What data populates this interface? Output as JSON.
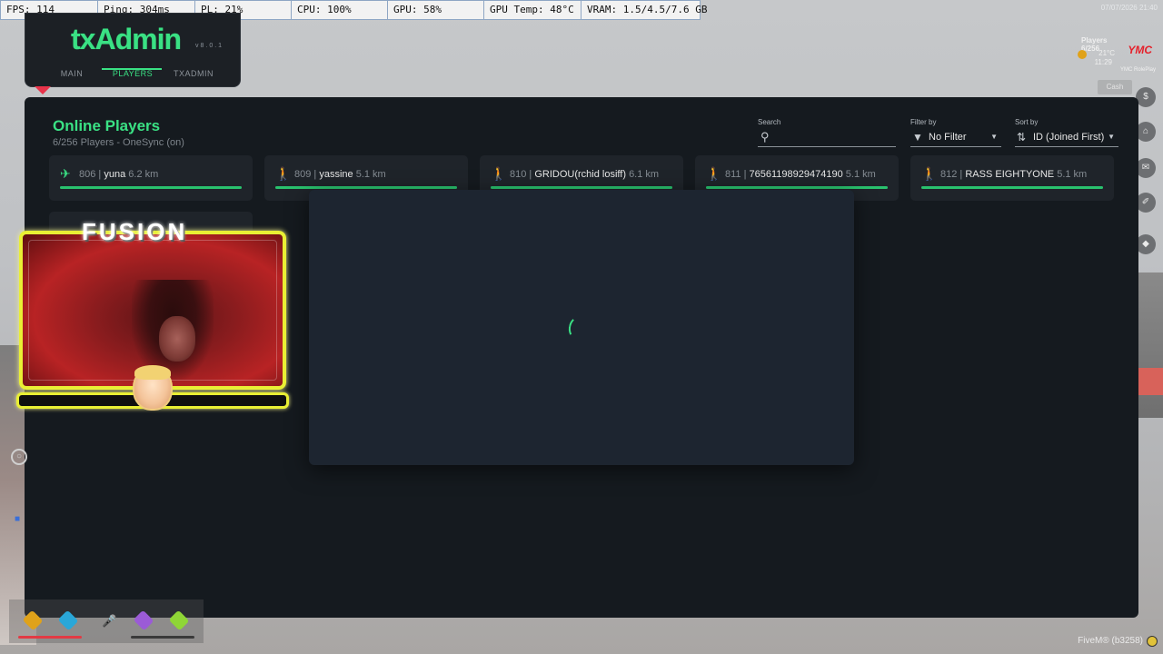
{
  "perf_bar": {
    "fps": "FPS: 114",
    "ping": "Ping: 304ms",
    "pl": "PL: 21%",
    "cpu": "CPU: 100%",
    "gpu": "GPU: 58%",
    "gpu_temp": "GPU Temp: 48°C",
    "vram": "VRAM: 1.5/4.5/7.6 GB"
  },
  "game_hud": {
    "date": "07/07/2026 21:40",
    "players": "Players 6/256",
    "logo": "YMC",
    "weather": "21°C",
    "clock": "11:29",
    "server": "YMC RolePlay",
    "cash": "Cash",
    "side_icons": [
      "$",
      "⌂",
      "✉",
      "✐",
      "◆"
    ],
    "fivem_label": "FiveM® (b3258)"
  },
  "txadmin": {
    "logo": "txAdmin",
    "version": "v8.0.1",
    "tabs": [
      {
        "label": "MAIN",
        "active": false
      },
      {
        "label": "PLAYERS",
        "active": true
      },
      {
        "label": "TXADMIN",
        "active": false
      }
    ]
  },
  "players_panel": {
    "title": "Online Players",
    "subtitle": "6/256 Players - OneSync (on)",
    "search": {
      "label": "Search",
      "value": ""
    },
    "filter": {
      "label": "Filter by",
      "value": "No Filter"
    },
    "sort": {
      "label": "Sort by",
      "value": "ID (Joined First)"
    },
    "players": [
      {
        "id": "806",
        "name": "yuna",
        "distance": "6.2 km",
        "icon": "plane-icon",
        "health": 1.0
      },
      {
        "id": "809",
        "name": "yassine",
        "distance": "5.1 km",
        "icon": "walking-icon",
        "health": 1.0
      },
      {
        "id": "810",
        "name": "GRIDOU(rchid losiff)",
        "distance": "6.1 km",
        "icon": "walking-icon",
        "health": 1.0
      },
      {
        "id": "811",
        "name": "76561198929474190",
        "distance": "5.1 km",
        "icon": "walking-icon",
        "health": 1.0
      },
      {
        "id": "812",
        "name": "RASS EIGHTYONE",
        "distance": "5.1 km",
        "icon": "walking-icon",
        "health": 1.0
      }
    ]
  },
  "modal": {
    "state": "loading"
  },
  "webcam": {
    "title": "FUSION"
  },
  "colors": {
    "accent": "#3ae184",
    "panel_bg": "#151a1f",
    "card_bg": "#1f242a",
    "modal_bg": "#1d2530",
    "webcam_border": "#e9ef34",
    "status_colors": [
      "#e0a21a",
      "#2aa7d8",
      "#9b5bd6",
      "#8fd636"
    ]
  }
}
